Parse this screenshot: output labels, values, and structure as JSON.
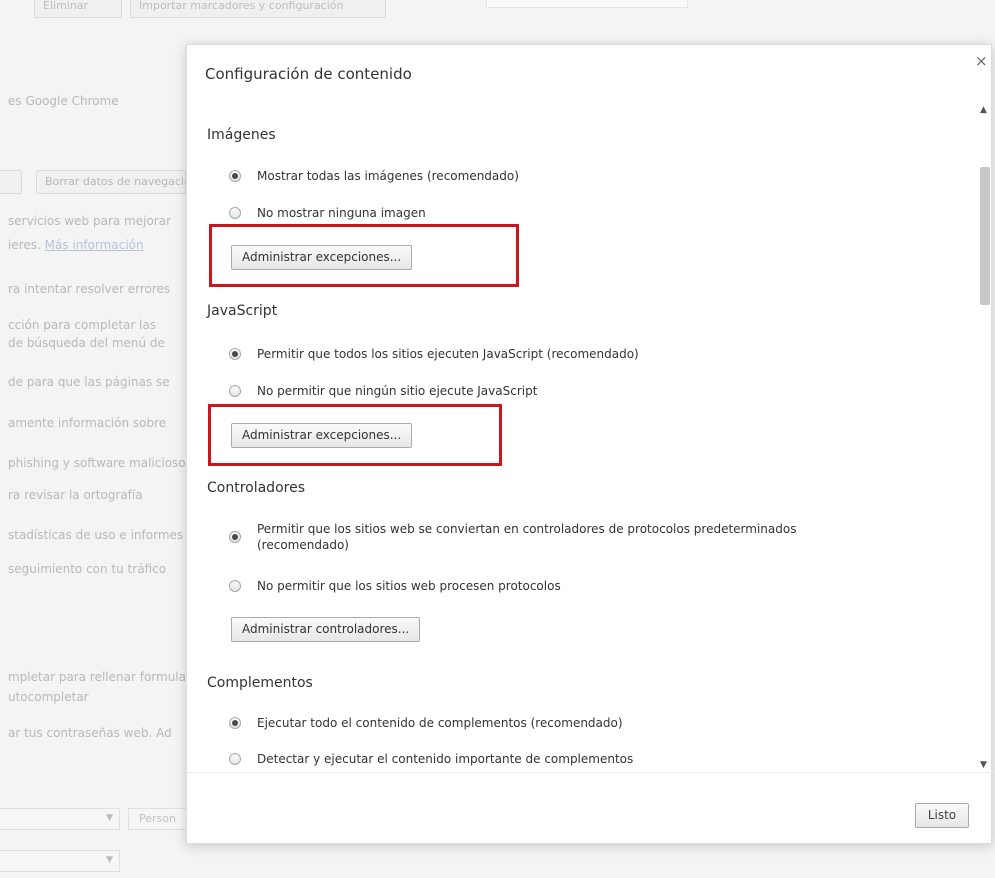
{
  "background": {
    "top_buttons": [
      "Eliminar",
      "Importar marcadores y configuración"
    ],
    "lines": [
      "es Google Chrome",
      "servicios web para mejorar",
      "ieres.",
      "Más información",
      "ra intentar resolver errores",
      "cción para completar las",
      "de búsqueda del menú de",
      "de para que las páginas se",
      "amente información sobre",
      "phishing y software malicioso",
      "ra revisar la ortografía",
      "stadísticas de uso e informes",
      "seguimiento con tu tráfico",
      "mpletar para rellenar formularios",
      "utocompletar",
      "ar tus contraseñas web. Ad"
    ],
    "buttons": [
      "",
      "Borrar datos de navegación"
    ],
    "select_partial_label": "Person"
  },
  "dialog": {
    "title": "Configuración de contenido",
    "close_icon": "×",
    "sections": {
      "images": {
        "title": "Imágenes",
        "options": [
          "Mostrar todas las imágenes (recomendado)",
          "No mostrar ninguna imagen"
        ],
        "button": "Administrar excepciones..."
      },
      "javascript": {
        "title": "JavaScript",
        "options": [
          "Permitir que todos los sitios ejecuten JavaScript (recomendado)",
          "No permitir que ningún sitio ejecute JavaScript"
        ],
        "button": "Administrar excepciones..."
      },
      "handlers": {
        "title": "Controladores",
        "options": [
          "Permitir que los sitios web se conviertan en controladores de protocolos predeterminados (recomendado)",
          "No permitir que los sitios web procesen protocolos"
        ],
        "button": "Administrar controladores..."
      },
      "plugins": {
        "title": "Complementos",
        "options": [
          "Ejecutar todo el contenido de complementos (recomendado)",
          "Detectar y ejecutar el contenido importante de complementos"
        ]
      }
    },
    "scroll_up": "▲",
    "scroll_down": "▼",
    "done_label": "Listo"
  },
  "colors": {
    "highlight": "#c8171e"
  }
}
